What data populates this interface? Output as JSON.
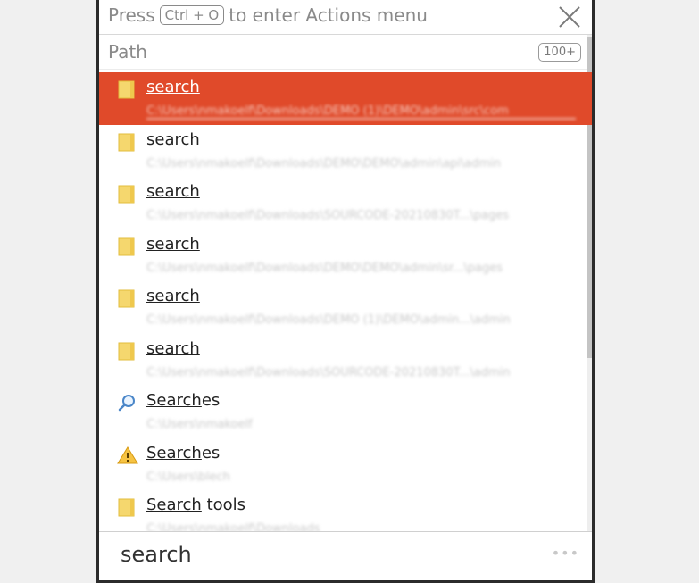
{
  "header": {
    "hint_prefix": "Press",
    "hint_key": "Ctrl + O",
    "hint_suffix": "to enter Actions menu"
  },
  "filter": {
    "label": "Path",
    "count": "100+"
  },
  "results": [
    {
      "match": "search",
      "rest": "",
      "icon": "folder-icon",
      "path": "C:\\Users\\nmakoelf\\Downloads\\DEMO (1)\\DEMO\\admin\\src\\com",
      "selected": true
    },
    {
      "match": "search",
      "rest": "",
      "icon": "folder-icon",
      "path": "C:\\Users\\nmakoelf\\Downloads\\DEMO\\DEMO\\admin\\api\\admin",
      "selected": false
    },
    {
      "match": "search",
      "rest": "",
      "icon": "folder-icon",
      "path": "C:\\Users\\nmakoelf\\Downloads\\SOURCODE-20210830T...\\pages",
      "selected": false
    },
    {
      "match": "search",
      "rest": "",
      "icon": "folder-icon",
      "path": "C:\\Users\\nmakoelf\\Downloads\\DEMO\\DEMO\\admin\\sr...\\pages",
      "selected": false
    },
    {
      "match": "search",
      "rest": "",
      "icon": "folder-icon",
      "path": "C:\\Users\\nmakoelf\\Downloads\\DEMO (1)\\DEMO\\admin...\\admin",
      "selected": false
    },
    {
      "match": "search",
      "rest": "",
      "icon": "folder-icon",
      "path": "C:\\Users\\nmakoelf\\Downloads\\SOURCODE-20210830T...\\admin",
      "selected": false
    },
    {
      "match": "Search",
      "rest": "es",
      "icon": "magnifier-icon",
      "path": "C:\\Users\\nmakoelf",
      "selected": false
    },
    {
      "match": "Search",
      "rest": "es",
      "icon": "warning-icon",
      "path": "C:\\Users\\blech",
      "selected": false
    },
    {
      "match": "Search",
      "rest": " tools",
      "icon": "folder-icon",
      "path": "C:\\Users\\nmakoelf\\Downloads",
      "selected": false
    }
  ],
  "query": {
    "value": "search"
  },
  "more": {
    "label": "•••"
  },
  "colors": {
    "selected_bg": "#e04a2a",
    "folder": "#f5d76e"
  }
}
